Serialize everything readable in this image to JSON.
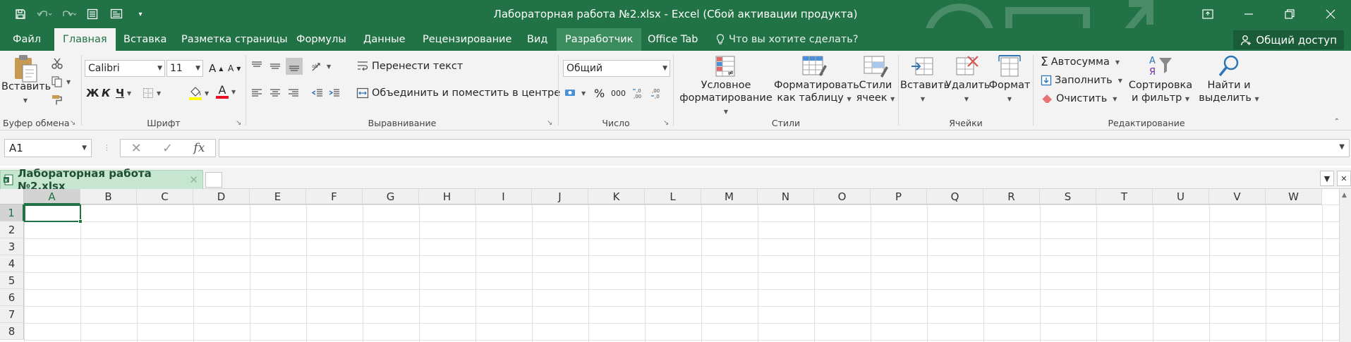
{
  "window": {
    "title": "Лабораторная работа №2.xlsx - Excel (Сбой активации продукта)"
  },
  "ribbon_tabs": [
    "Файл",
    "Главная",
    "Вставка",
    "Разметка страницы",
    "Формулы",
    "Данные",
    "Рецензирование",
    "Вид",
    "Разработчик",
    "Office Tab"
  ],
  "active_tab": "Главная",
  "tell_me": "Что вы хотите сделать?",
  "share": "Общий доступ",
  "clipboard": {
    "paste": "Вставить",
    "label": "Буфер обмена"
  },
  "font": {
    "name": "Calibri",
    "size": "11",
    "bold": "Ж",
    "italic": "К",
    "underline": "Ч",
    "grow": "A",
    "shrink": "A",
    "color_letter": "A",
    "label": "Шрифт"
  },
  "alignment": {
    "wrap": "Перенести текст",
    "merge": "Объединить и поместить в центре",
    "label": "Выравнивание"
  },
  "number": {
    "format": "Общий",
    "percent": "%",
    "thousands": "000",
    "label": "Число"
  },
  "styles": {
    "conditional_1": "Условное",
    "conditional_2": "форматирование",
    "table_1": "Форматировать",
    "table_2": "как таблицу",
    "cell_1": "Стили",
    "cell_2": "ячеек",
    "label": "Стили"
  },
  "cells_group": {
    "insert": "Вставить",
    "delete": "Удалить",
    "format": "Формат",
    "label": "Ячейки"
  },
  "editing": {
    "autosum": "Автосумма",
    "fill": "Заполнить",
    "clear": "Очистить",
    "sort_1": "Сортировка",
    "sort_2": "и фильтр",
    "find_1": "Найти и",
    "find_2": "выделить",
    "label": "Редактирование"
  },
  "formula_bar": {
    "name_box": "A1",
    "fx": "fx",
    "value": ""
  },
  "workbook_tab": {
    "name": "Лабораторная работа №2.xlsx"
  },
  "sheet": {
    "columns": [
      "A",
      "B",
      "C",
      "D",
      "E",
      "F",
      "G",
      "H",
      "I",
      "J",
      "K",
      "L",
      "M",
      "N",
      "O",
      "P",
      "Q",
      "R",
      "S",
      "T",
      "U",
      "V",
      "W"
    ],
    "rows": [
      "1",
      "2",
      "3",
      "4",
      "5",
      "6",
      "7",
      "8"
    ],
    "active_cell": "A1"
  },
  "colors": {
    "accent": "#217346",
    "ribbon_bg": "#f3f3f3"
  }
}
